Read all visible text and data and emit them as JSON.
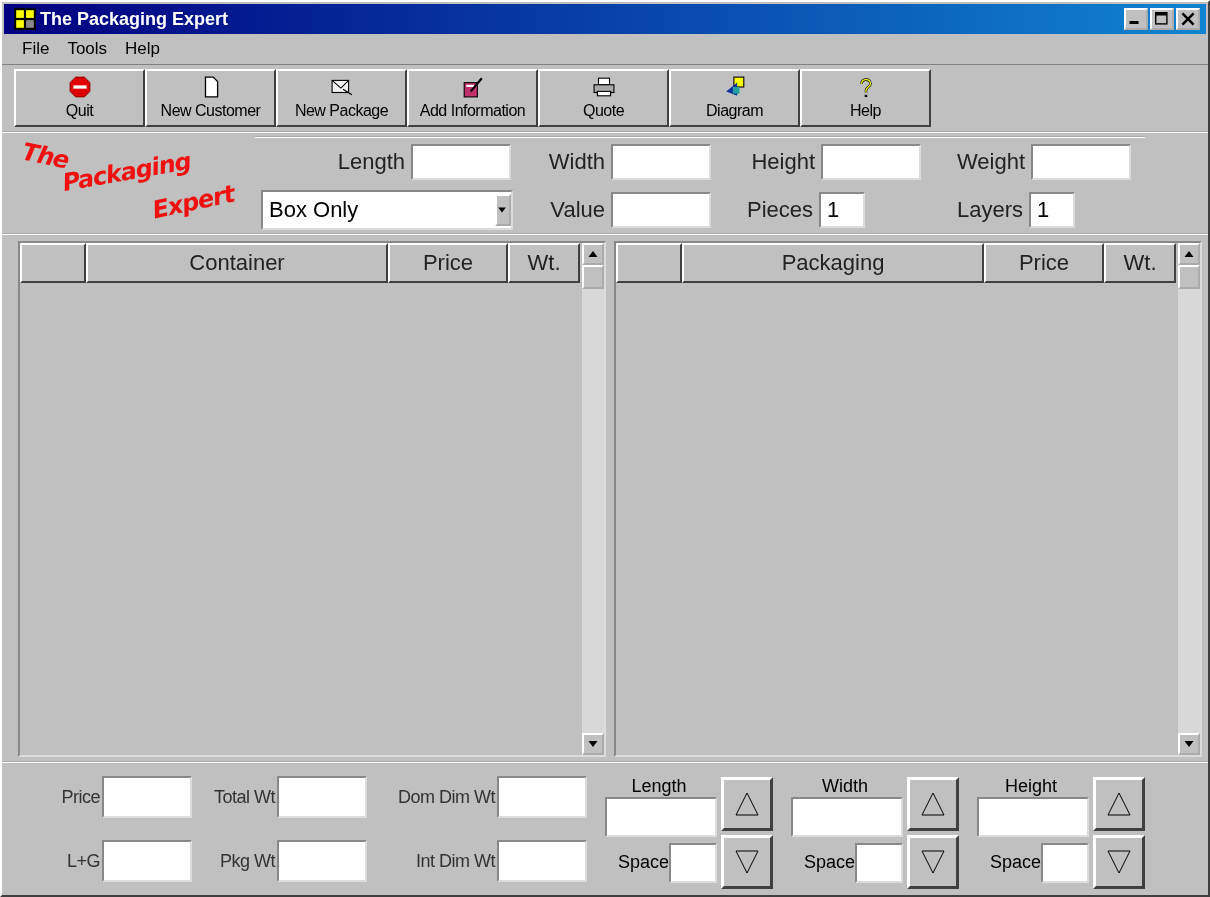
{
  "window": {
    "title": "The Packaging Expert"
  },
  "menu": [
    {
      "label": "File"
    },
    {
      "label": "Tools"
    },
    {
      "label": "Help"
    }
  ],
  "toolbar": [
    {
      "label": "Quit",
      "kind": "stop"
    },
    {
      "label": "New Customer",
      "kind": "page"
    },
    {
      "label": "New Package",
      "kind": "envelope"
    },
    {
      "label": "Add Information",
      "kind": "edit"
    },
    {
      "label": "Quote",
      "kind": "printer"
    },
    {
      "label": "Diagram",
      "kind": "shapes"
    },
    {
      "label": "Help",
      "kind": "help"
    }
  ],
  "logo": {
    "lines": [
      "The",
      "Packaging",
      "Expert"
    ]
  },
  "params": [
    {
      "label": "Length",
      "kind": "text"
    },
    {
      "label": "Width",
      "kind": "text"
    },
    {
      "label": "Height",
      "kind": "text"
    },
    {
      "label": "Weight",
      "kind": "text"
    },
    {
      "kind": "dropdown",
      "value": "Box Only"
    },
    {
      "label": "Value",
      "kind": "text"
    },
    {
      "label": "Pieces",
      "kind": "small",
      "value": "1"
    },
    {
      "label": "Layers",
      "kind": "small",
      "value": "1"
    }
  ],
  "grids": [
    {
      "columns": [
        "Container",
        "Price",
        "Wt."
      ]
    },
    {
      "columns": [
        "Packaging",
        "Price",
        "Wt."
      ]
    }
  ],
  "totals": [
    {
      "label": "Price"
    },
    {
      "label": "L+G"
    },
    {
      "label": "Total Wt"
    },
    {
      "label": "Pkg Wt"
    },
    {
      "label": "Dom Dim Wt"
    },
    {
      "label": "Int Dim Wt"
    }
  ],
  "spinners": [
    {
      "label": "Length",
      "space_label": "Space"
    },
    {
      "label": "Width",
      "space_label": "Space"
    },
    {
      "label": "Height",
      "space_label": "Space"
    }
  ]
}
